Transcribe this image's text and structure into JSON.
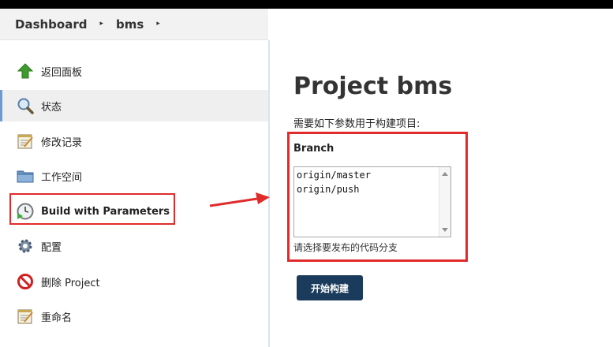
{
  "breadcrumb": {
    "items": [
      "Dashboard",
      "bms"
    ],
    "separator": "▸"
  },
  "sidebar": {
    "items": [
      {
        "label": "返回面板",
        "icon": "up-arrow-icon"
      },
      {
        "label": "状态",
        "icon": "magnifier-icon",
        "active": true
      },
      {
        "label": "修改记录",
        "icon": "notepad-icon"
      },
      {
        "label": "工作空间",
        "icon": "folder-icon"
      },
      {
        "label": "Build with Parameters",
        "icon": "clock-play-icon"
      },
      {
        "label": "配置",
        "icon": "gear-icon"
      },
      {
        "label": "删除 Project",
        "icon": "no-entry-icon"
      },
      {
        "label": "重命名",
        "icon": "notepad-icon"
      }
    ]
  },
  "main": {
    "title": "Project bms",
    "description": "需要如下参数用于构建项目:",
    "parameter": {
      "name": "Branch",
      "options": [
        "origin/master",
        "origin/push"
      ],
      "hint": "请选择要发布的代码分支"
    },
    "build_button": "开始构建"
  },
  "colors": {
    "highlight": "#e02b2b",
    "button": "#1a3b5c",
    "active_border": "#6b9bd1"
  }
}
